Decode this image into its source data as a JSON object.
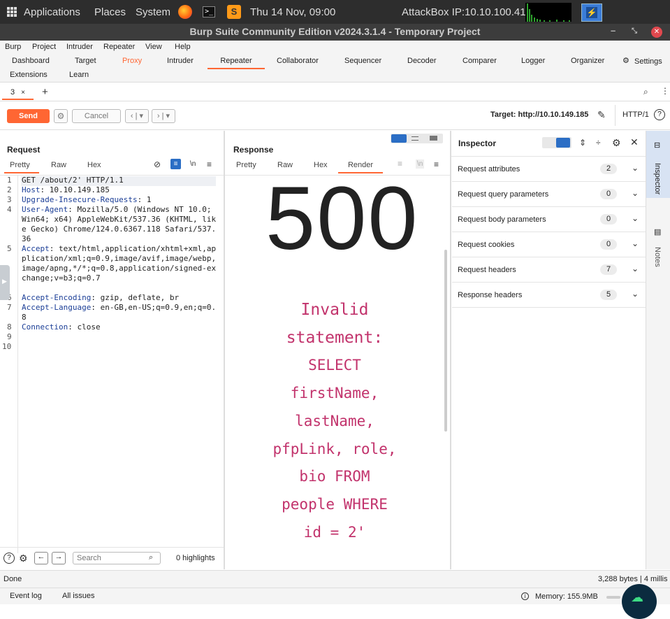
{
  "sysbar": {
    "applications": "Applications",
    "places": "Places",
    "system": "System",
    "datetime": "Thu 14 Nov, 09:00",
    "attackbox": "AttackBox IP:10.10.100.41"
  },
  "window": {
    "title": "Burp Suite Community Edition v2024.3.1.4 - Temporary Project"
  },
  "menu": [
    "Burp",
    "Project",
    "Intruder",
    "Repeater",
    "View",
    "Help"
  ],
  "tabs": {
    "row1": [
      "Dashboard",
      "Target",
      "Proxy",
      "Intruder",
      "Repeater",
      "Collaborator",
      "Sequencer",
      "Decoder",
      "Comparer",
      "Logger",
      "Organizer"
    ],
    "settings": "Settings",
    "row2": [
      "Extensions",
      "Learn"
    ]
  },
  "subtab": {
    "label": "3",
    "close": "×",
    "add": "+"
  },
  "toolbar": {
    "send": "Send",
    "cancel": "Cancel",
    "target": "Target: http://10.10.149.185",
    "http": "HTTP/1"
  },
  "request": {
    "title": "Request",
    "views": [
      "Pretty",
      "Raw",
      "Hex"
    ],
    "newline": "\\n",
    "line_numbers": [
      "1",
      "2",
      "3",
      "4",
      "",
      "",
      "",
      "5",
      "",
      "",
      "",
      "",
      "6",
      "7",
      "",
      "8",
      "9",
      "10"
    ],
    "lines": [
      {
        "n": "1",
        "head": "",
        "text": "GET /about/2' HTTP/1.1"
      },
      {
        "n": "2",
        "head": "Host",
        "text": ": 10.10.149.185"
      },
      {
        "n": "3",
        "head": "Upgrade-Insecure-Requests",
        "text": ": 1"
      },
      {
        "n": "4",
        "head": "User-Agent",
        "text": ": Mozilla/5.0 (Windows NT 10.0; Win64; x64) AppleWebKit/537.36 (KHTML, like Gecko) Chrome/124.0.6367.118 Safari/537.36"
      },
      {
        "n": "5",
        "head": "Accept",
        "text": ": text/html,application/xhtml+xml,application/xml;q=0.9,image/avif,image/webp,image/apng,*/*;q=0.8,application/signed-exchange;v=b3;q=0.7"
      },
      {
        "n": "6",
        "head": "Accept-Encoding",
        "text": ": gzip, deflate, br"
      },
      {
        "n": "7",
        "head": "Accept-Language",
        "text": ": en-GB,en-US;q=0.9,en;q=0.8"
      },
      {
        "n": "8",
        "head": "Connection",
        "text": ": close"
      },
      {
        "n": "9",
        "head": "",
        "text": ""
      },
      {
        "n": "10",
        "head": "",
        "text": ""
      }
    ],
    "search_placeholder": "Search",
    "highlights": "0 highlights"
  },
  "response": {
    "title": "Response",
    "views": [
      "Pretty",
      "Raw",
      "Hex",
      "Render"
    ],
    "newline": "\\n",
    "big": "500",
    "message_lines": [
      "Invalid",
      "statement:",
      "SELECT",
      "firstName,",
      "lastName,",
      "pfpLink, role,",
      "bio FROM",
      "people WHERE",
      "id = 2'"
    ]
  },
  "inspector": {
    "title": "Inspector",
    "rows": [
      {
        "label": "Request attributes",
        "count": "2"
      },
      {
        "label": "Request query parameters",
        "count": "0"
      },
      {
        "label": "Request body parameters",
        "count": "0"
      },
      {
        "label": "Request cookies",
        "count": "0"
      },
      {
        "label": "Request headers",
        "count": "7"
      },
      {
        "label": "Response headers",
        "count": "5"
      }
    ]
  },
  "side": {
    "inspector": "Inspector",
    "notes": "Notes"
  },
  "status": {
    "left": "Done",
    "right": "3,288 bytes | 4 millis"
  },
  "bottom": {
    "event_log": "Event log",
    "all_issues": "All issues",
    "memory": "Memory: 155.9MB"
  },
  "colors": {
    "accent": "#ff6633",
    "error_text": "#c2336c",
    "header_key": "#1a3d96"
  }
}
